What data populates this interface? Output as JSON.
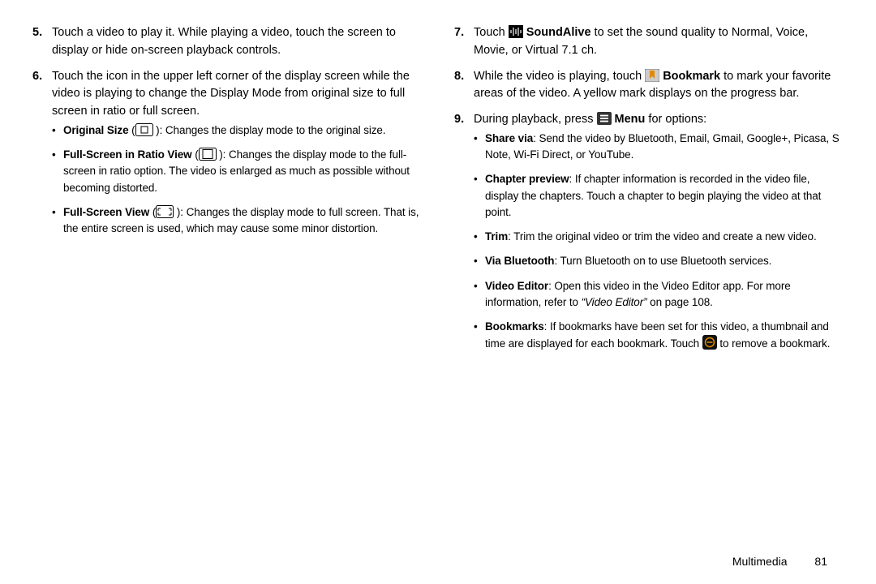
{
  "left": {
    "items": {
      "5": {
        "num": "5.",
        "text": "Touch a video to play it. While playing a video, touch the screen to display or hide on-screen playback controls."
      },
      "6": {
        "num": "6.",
        "text": "Touch the icon in the upper left corner of the display screen while the video is playing to change the Display Mode from original size to full screen in ratio or full screen.",
        "sub": {
          "original": {
            "lead": "Original Size",
            "icon": "original-size-icon",
            "open": " (",
            "close": " ): ",
            "rest": "Changes the display mode to the original size."
          },
          "ratio": {
            "lead": "Full-Screen in Ratio View",
            "icon": "ratio-view-icon",
            "open": " (",
            "close": " ): ",
            "rest": "Changes the display mode to the full-screen in ratio option. The video is enlarged as much as possible without becoming distorted."
          },
          "full": {
            "lead": "Full-Screen View",
            "icon": "full-screen-icon",
            "open": " (",
            "close": " ): ",
            "rest": "Changes the display mode to full screen. That is, the entire screen is used, which may cause some minor distortion."
          }
        }
      }
    }
  },
  "right": {
    "items": {
      "7": {
        "num": "7.",
        "pre": "Touch ",
        "icon": "soundalive-icon",
        "lbl": " SoundAlive",
        "post": " to set the sound quality to Normal, Voice, Movie, or Virtual 7.1 ch."
      },
      "8": {
        "num": "8.",
        "pre": "While the video is playing, touch ",
        "icon": "bookmark-icon",
        "lbl": " Bookmark",
        "post": " to mark your favorite areas of the video. A yellow mark displays on the progress bar."
      },
      "9": {
        "num": "9.",
        "pre": "During playback, press ",
        "icon": "menu-icon",
        "lbl": " Menu",
        "post": " for options:",
        "sub": {
          "share": {
            "lead": "Share via",
            "rest": ": Send the video by Bluetooth, Email, Gmail, Google+, Picasa, S Note, Wi-Fi Direct, or YouTube."
          },
          "chapter": {
            "lead": "Chapter preview",
            "rest": ": If chapter information is recorded in the video file, display the chapters. Touch a chapter to begin playing the video at that point."
          },
          "trim": {
            "lead": "Trim",
            "rest": ": Trim the original video or trim the video and create a new video."
          },
          "bt": {
            "lead": "Via Bluetooth",
            "rest": ": Turn Bluetooth on to use Bluetooth services."
          },
          "ve": {
            "lead": "Video Editor",
            "rest1": ": Open this video in the Video Editor app. For more information, refer to ",
            "ref": "“Video Editor”",
            "rest2": "  on page 108."
          },
          "bm": {
            "lead": "Bookmarks",
            "rest1": ": If bookmarks have been set for this video, a thumbnail and time are displayed for each bookmark. Touch ",
            "icon": "remove-bookmark-icon",
            "rest2": " to remove a bookmark."
          }
        }
      }
    }
  },
  "footer": {
    "section": "Multimedia",
    "page": "81"
  }
}
